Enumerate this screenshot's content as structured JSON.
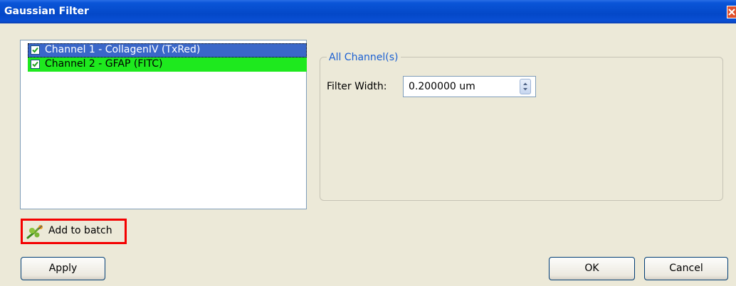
{
  "window": {
    "title": "Gaussian Filter"
  },
  "channels": [
    {
      "label": "Channel 1 - CollagenIV (TxRed)",
      "checked": true,
      "selected": true,
      "color": "#3a67c9"
    },
    {
      "label": "Channel 2 - GFAP (FITC)",
      "checked": true,
      "selected": false,
      "color": "#1ee91e"
    }
  ],
  "settings": {
    "group_title": "All Channel(s)",
    "filter_width_label": "Filter Width:",
    "filter_width_value": "0.200000 um"
  },
  "actions": {
    "add_to_batch_label": "Add to batch",
    "apply_label": "Apply",
    "ok_label": "OK",
    "cancel_label": "Cancel"
  },
  "icons": {
    "close": "close-icon",
    "checkbox": "checkmark-icon",
    "spin": "spin-arrows-icon",
    "batch": "add-to-batch-icon"
  },
  "colors": {
    "titlebar": "#0448c8",
    "highlight_border": "#f40000",
    "group_title": "#1a5fd2"
  }
}
